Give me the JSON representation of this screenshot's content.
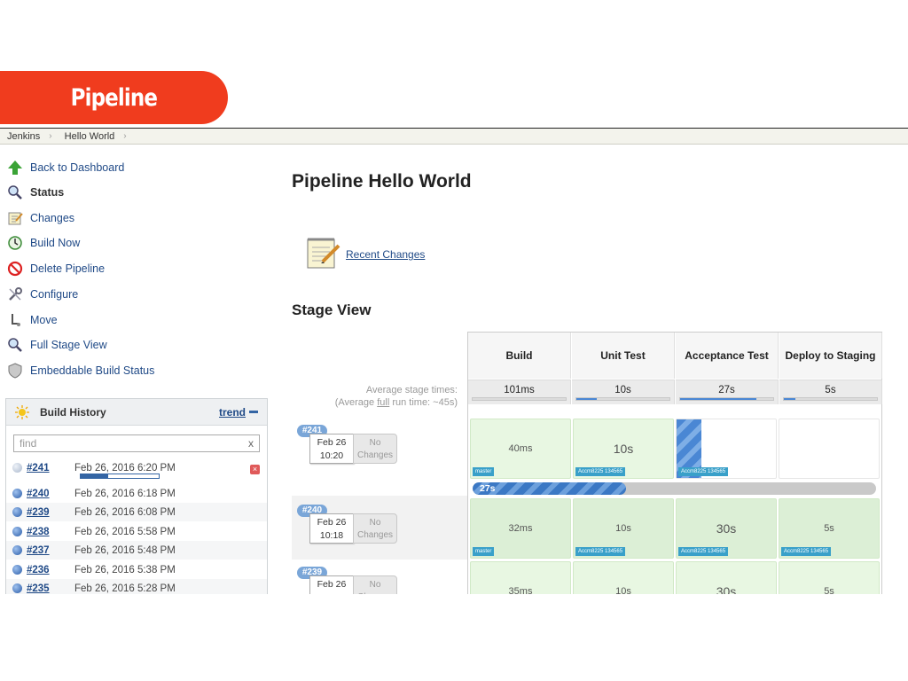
{
  "banner": {
    "title": "Pipeline"
  },
  "breadcrumb": [
    "Jenkins",
    "Hello World"
  ],
  "sidebar": {
    "tasks": [
      {
        "label": "Back to Dashboard",
        "icon": "arrow-up-icon"
      },
      {
        "label": "Status",
        "icon": "magnifier-icon"
      },
      {
        "label": "Changes",
        "icon": "notepad-icon"
      },
      {
        "label": "Build Now",
        "icon": "clock-icon"
      },
      {
        "label": "Delete Pipeline",
        "icon": "no-entry-icon"
      },
      {
        "label": "Configure",
        "icon": "wrench-icon"
      },
      {
        "label": "Move",
        "icon": "move-icon"
      },
      {
        "label": "Full Stage View",
        "icon": "magnifier-icon"
      },
      {
        "label": "Embeddable Build Status",
        "icon": "shield-icon"
      }
    ]
  },
  "build_history": {
    "title": "Build History",
    "trend": "trend",
    "find_placeholder": "find",
    "clear": "x",
    "builds": [
      {
        "num": "#241",
        "date": "Feb 26, 2016 6:20 PM",
        "status": "running",
        "progress": 0.35
      },
      {
        "num": "#240",
        "date": "Feb 26, 2016 6:18 PM",
        "status": "success"
      },
      {
        "num": "#239",
        "date": "Feb 26, 2016 6:08 PM",
        "status": "success"
      },
      {
        "num": "#238",
        "date": "Feb 26, 2016 5:58 PM",
        "status": "success"
      },
      {
        "num": "#237",
        "date": "Feb 26, 2016 5:48 PM",
        "status": "success"
      },
      {
        "num": "#236",
        "date": "Feb 26, 2016 5:38 PM",
        "status": "success"
      },
      {
        "num": "#235",
        "date": "Feb 26, 2016 5:28 PM",
        "status": "success"
      }
    ]
  },
  "main": {
    "title": "Pipeline Hello World",
    "recent_changes": "Recent Changes",
    "stage_view_title": "Stage View"
  },
  "stage_view": {
    "avg_line1": "Average stage times:",
    "avg_line2_pre": "(Average ",
    "avg_line2_link": "full",
    "avg_line2_post": " run time: ~45s)",
    "stages": [
      {
        "name": "Build",
        "avg": "101ms",
        "fill": 0
      },
      {
        "name": "Unit Test",
        "avg": "10s",
        "fill": 0.22
      },
      {
        "name": "Acceptance Test",
        "avg": "27s",
        "fill": 0.82
      },
      {
        "name": "Deploy to Staging",
        "avg": "5s",
        "fill": 0.12
      }
    ],
    "runs": [
      {
        "badge": "#241",
        "date": "Feb 26",
        "time": "10:20",
        "changes": "No Changes",
        "cells": [
          "40ms",
          "10s",
          "",
          ""
        ],
        "tags": [
          "master",
          "Accm8225 134565",
          "Accm8225 134565",
          ""
        ],
        "running": {
          "label": "27s",
          "progress": 0.38
        }
      },
      {
        "badge": "#240",
        "date": "Feb 26",
        "time": "10:18",
        "changes": "No Changes",
        "cells": [
          "32ms",
          "10s",
          "30s",
          "5s"
        ],
        "tags": [
          "master",
          "Accm8225 134565",
          "Accm8225 134565",
          "Accm8225 134565"
        ]
      },
      {
        "badge": "#239",
        "date": "Feb 26",
        "time": "",
        "changes": "No Changes",
        "cells": [
          "35ms",
          "10s",
          "30s",
          "5s"
        ],
        "tags": [
          "",
          "",
          "",
          ""
        ]
      }
    ]
  },
  "colors": {
    "banner": "#f03c1e",
    "link": "#204a87",
    "stage_success": "#e8f7e2",
    "progress": "#3465a4"
  }
}
